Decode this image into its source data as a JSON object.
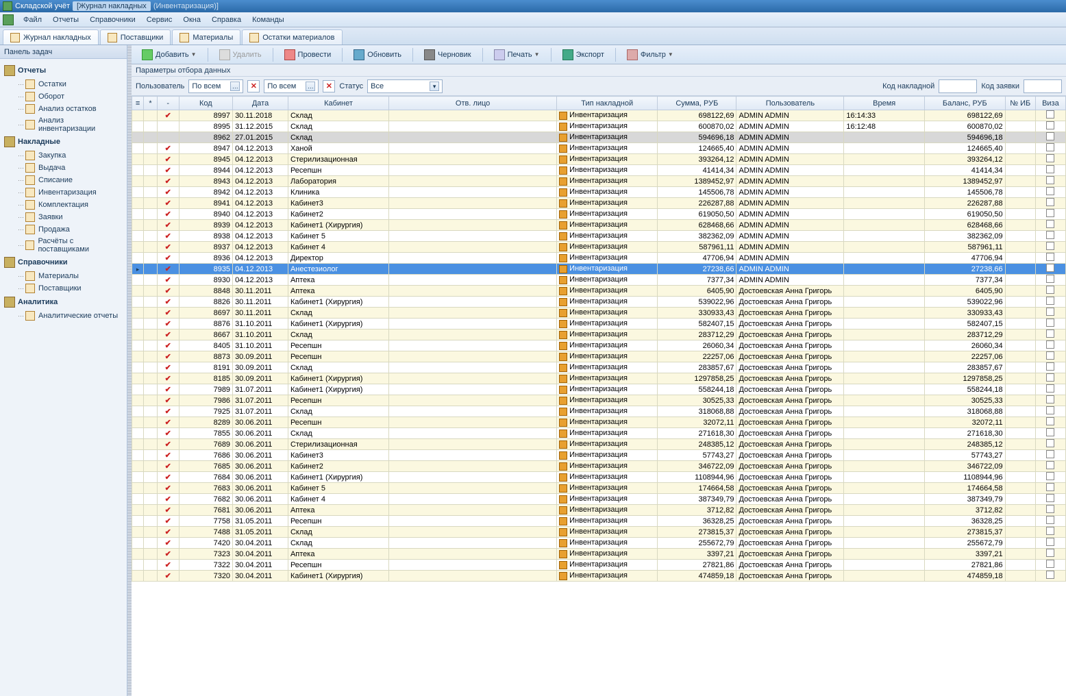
{
  "title": {
    "app": "Складской учёт",
    "active_tab": "[Журнал накладных",
    "subtitle": "(Инвентаризация)]"
  },
  "menu": [
    "Файл",
    "Отчеты",
    "Справочники",
    "Сервис",
    "Окна",
    "Справка",
    "Команды"
  ],
  "tabs": [
    {
      "label": "Журнал накладных",
      "active": true
    },
    {
      "label": "Поставщики",
      "active": false
    },
    {
      "label": "Материалы",
      "active": false
    },
    {
      "label": "Остатки материалов",
      "active": false
    }
  ],
  "sidepanel": {
    "title": "Панель задач",
    "groups": [
      {
        "title": "Отчеты",
        "items": [
          "Остатки",
          "Оборот",
          "Анализ остатков",
          "Анализ инвентаризации"
        ]
      },
      {
        "title": "Накладные",
        "items": [
          "Закупка",
          "Выдача",
          "Списание",
          "Инвентаризация",
          "Комплектация",
          "Заявки",
          "Продажа",
          "Расчёты с поставщиками"
        ]
      },
      {
        "title": "Справочники",
        "items": [
          "Материалы",
          "Поставщики"
        ]
      },
      {
        "title": "Аналитика",
        "items": [
          "Аналитические отчеты"
        ]
      }
    ]
  },
  "toolbar": {
    "add": "Добавить",
    "del": "Удалить",
    "post": "Провести",
    "refresh": "Обновить",
    "draft": "Черновик",
    "print": "Печать",
    "export": "Экспорт",
    "filter": "Фильтр"
  },
  "params": {
    "title": "Параметры отбора данных",
    "user_label": "Пользователь",
    "user_value": "По всем",
    "combo2_value": "По всем",
    "status_label": "Статус",
    "status_value": "Все",
    "code_label": "Код накладной",
    "req_label": "Код заявки"
  },
  "grid": {
    "headers": {
      "star": "*",
      "minus": "-",
      "code": "Код",
      "date": "Дата",
      "cab": "Кабинет",
      "resp": "Отв. лицо",
      "type": "Тип накладной",
      "sum": "Сумма, РУБ",
      "user": "Пользователь",
      "time": "Время",
      "bal": "Баланс, РУБ",
      "ib": "№ ИБ",
      "visa": "Виза"
    },
    "type_label": "Инвентаризация",
    "rows": [
      {
        "check": true,
        "code": "8997",
        "date": "30.11.2018",
        "cab": "Склад",
        "sum": "698122,69",
        "user": "ADMIN ADMIN",
        "time": "16:14:33",
        "bal": "698122,69"
      },
      {
        "check": false,
        "code": "8995",
        "date": "31.12.2015",
        "cab": "Склад",
        "sum": "600870,02",
        "user": "ADMIN ADMIN",
        "time": "16:12:48",
        "bal": "600870,02"
      },
      {
        "grey": true,
        "check": false,
        "code": "8962",
        "date": "27.01.2015",
        "cab": "Склад",
        "sum": "594696,18",
        "user": "ADMIN ADMIN",
        "bal": "594696,18"
      },
      {
        "check": true,
        "code": "8947",
        "date": "04.12.2013",
        "cab": "Ханой",
        "sum": "124665,40",
        "user": "ADMIN ADMIN",
        "bal": "124665,40"
      },
      {
        "check": true,
        "code": "8945",
        "date": "04.12.2013",
        "cab": "Стерилизационная",
        "sum": "393264,12",
        "user": "ADMIN ADMIN",
        "bal": "393264,12"
      },
      {
        "check": true,
        "code": "8944",
        "date": "04.12.2013",
        "cab": "Ресепшн",
        "sum": "41414,34",
        "user": "ADMIN ADMIN",
        "bal": "41414,34"
      },
      {
        "check": true,
        "code": "8943",
        "date": "04.12.2013",
        "cab": "Лаборатория",
        "sum": "1389452,97",
        "user": "ADMIN ADMIN",
        "bal": "1389452,97"
      },
      {
        "check": true,
        "code": "8942",
        "date": "04.12.2013",
        "cab": "Клиника",
        "sum": "145506,78",
        "user": "ADMIN ADMIN",
        "bal": "145506,78"
      },
      {
        "check": true,
        "code": "8941",
        "date": "04.12.2013",
        "cab": "Кабинет3",
        "sum": "226287,88",
        "user": "ADMIN ADMIN",
        "bal": "226287,88"
      },
      {
        "check": true,
        "code": "8940",
        "date": "04.12.2013",
        "cab": "Кабинет2",
        "sum": "619050,50",
        "user": "ADMIN ADMIN",
        "bal": "619050,50"
      },
      {
        "check": true,
        "code": "8939",
        "date": "04.12.2013",
        "cab": "Кабинет1 (Хирургия)",
        "sum": "628468,66",
        "user": "ADMIN ADMIN",
        "bal": "628468,66"
      },
      {
        "check": true,
        "code": "8938",
        "date": "04.12.2013",
        "cab": "Кабинет 5",
        "sum": "382362,09",
        "user": "ADMIN ADMIN",
        "bal": "382362,09"
      },
      {
        "check": true,
        "code": "8937",
        "date": "04.12.2013",
        "cab": "Кабинет 4",
        "sum": "587961,11",
        "user": "ADMIN ADMIN",
        "bal": "587961,11"
      },
      {
        "check": true,
        "code": "8936",
        "date": "04.12.2013",
        "cab": "Директор",
        "sum": "47706,94",
        "user": "ADMIN ADMIN",
        "bal": "47706,94"
      },
      {
        "selected": true,
        "ptr": true,
        "check": true,
        "code": "8935",
        "date": "04.12.2013",
        "cab": "Анестезиолог",
        "sum": "27238,66",
        "user": "ADMIN ADMIN",
        "bal": "27238,66"
      },
      {
        "check": true,
        "code": "8930",
        "date": "04.12.2013",
        "cab": "Аптека",
        "sum": "7377,34",
        "user": "ADMIN ADMIN",
        "bal": "7377,34"
      },
      {
        "check": true,
        "code": "8848",
        "date": "30.11.2011",
        "cab": "Аптека",
        "sum": "6405,90",
        "user": "Достоевская Анна Григорь",
        "bal": "6405,90"
      },
      {
        "check": true,
        "code": "8826",
        "date": "30.11.2011",
        "cab": "Кабинет1 (Хирургия)",
        "sum": "539022,96",
        "user": "Достоевская Анна Григорь",
        "bal": "539022,96"
      },
      {
        "check": true,
        "code": "8697",
        "date": "30.11.2011",
        "cab": "Склад",
        "sum": "330933,43",
        "user": "Достоевская Анна Григорь",
        "bal": "330933,43"
      },
      {
        "check": true,
        "code": "8876",
        "date": "31.10.2011",
        "cab": "Кабинет1 (Хирургия)",
        "sum": "582407,15",
        "user": "Достоевская Анна Григорь",
        "bal": "582407,15"
      },
      {
        "check": true,
        "code": "8667",
        "date": "31.10.2011",
        "cab": "Склад",
        "sum": "283712,29",
        "user": "Достоевская Анна Григорь",
        "bal": "283712,29"
      },
      {
        "check": true,
        "code": "8405",
        "date": "31.10.2011",
        "cab": "Ресепшн",
        "sum": "26060,34",
        "user": "Достоевская Анна Григорь",
        "bal": "26060,34"
      },
      {
        "check": true,
        "code": "8873",
        "date": "30.09.2011",
        "cab": "Ресепшн",
        "sum": "22257,06",
        "user": "Достоевская Анна Григорь",
        "bal": "22257,06"
      },
      {
        "check": true,
        "code": "8191",
        "date": "30.09.2011",
        "cab": "Склад",
        "sum": "283857,67",
        "user": "Достоевская Анна Григорь",
        "bal": "283857,67"
      },
      {
        "check": true,
        "code": "8185",
        "date": "30.09.2011",
        "cab": "Кабинет1 (Хирургия)",
        "sum": "1297858,25",
        "user": "Достоевская Анна Григорь",
        "bal": "1297858,25"
      },
      {
        "check": true,
        "code": "7989",
        "date": "31.07.2011",
        "cab": "Кабинет1 (Хирургия)",
        "sum": "558244,18",
        "user": "Достоевская Анна Григорь",
        "bal": "558244,18"
      },
      {
        "check": true,
        "code": "7986",
        "date": "31.07.2011",
        "cab": "Ресепшн",
        "sum": "30525,33",
        "user": "Достоевская Анна Григорь",
        "bal": "30525,33"
      },
      {
        "check": true,
        "code": "7925",
        "date": "31.07.2011",
        "cab": "Склад",
        "sum": "318068,88",
        "user": "Достоевская Анна Григорь",
        "bal": "318068,88"
      },
      {
        "check": true,
        "code": "8289",
        "date": "30.06.2011",
        "cab": "Ресепшн",
        "sum": "32072,11",
        "user": "Достоевская Анна Григорь",
        "bal": "32072,11"
      },
      {
        "check": true,
        "code": "7855",
        "date": "30.06.2011",
        "cab": "Склад",
        "sum": "271618,30",
        "user": "Достоевская Анна Григорь",
        "bal": "271618,30"
      },
      {
        "check": true,
        "code": "7689",
        "date": "30.06.2011",
        "cab": "Стерилизационная",
        "sum": "248385,12",
        "user": "Достоевская Анна Григорь",
        "bal": "248385,12"
      },
      {
        "check": true,
        "code": "7686",
        "date": "30.06.2011",
        "cab": "Кабинет3",
        "sum": "57743,27",
        "user": "Достоевская Анна Григорь",
        "bal": "57743,27"
      },
      {
        "check": true,
        "code": "7685",
        "date": "30.06.2011",
        "cab": "Кабинет2",
        "sum": "346722,09",
        "user": "Достоевская Анна Григорь",
        "bal": "346722,09"
      },
      {
        "check": true,
        "code": "7684",
        "date": "30.06.2011",
        "cab": "Кабинет1 (Хирургия)",
        "sum": "1108944,96",
        "user": "Достоевская Анна Григорь",
        "bal": "1108944,96"
      },
      {
        "check": true,
        "code": "7683",
        "date": "30.06.2011",
        "cab": "Кабинет 5",
        "sum": "174664,58",
        "user": "Достоевская Анна Григорь",
        "bal": "174664,58"
      },
      {
        "check": true,
        "code": "7682",
        "date": "30.06.2011",
        "cab": "Кабинет 4",
        "sum": "387349,79",
        "user": "Достоевская Анна Григорь",
        "bal": "387349,79"
      },
      {
        "check": true,
        "code": "7681",
        "date": "30.06.2011",
        "cab": "Аптека",
        "sum": "3712,82",
        "user": "Достоевская Анна Григорь",
        "bal": "3712,82"
      },
      {
        "check": true,
        "code": "7758",
        "date": "31.05.2011",
        "cab": "Ресепшн",
        "sum": "36328,25",
        "user": "Достоевская Анна Григорь",
        "bal": "36328,25"
      },
      {
        "check": true,
        "code": "7488",
        "date": "31.05.2011",
        "cab": "Склад",
        "sum": "273815,37",
        "user": "Достоевская Анна Григорь",
        "bal": "273815,37"
      },
      {
        "check": true,
        "code": "7420",
        "date": "30.04.2011",
        "cab": "Склад",
        "sum": "255672,79",
        "user": "Достоевская Анна Григорь",
        "bal": "255672,79"
      },
      {
        "check": true,
        "code": "7323",
        "date": "30.04.2011",
        "cab": "Аптека",
        "sum": "3397,21",
        "user": "Достоевская Анна Григорь",
        "bal": "3397,21"
      },
      {
        "check": true,
        "code": "7322",
        "date": "30.04.2011",
        "cab": "Ресепшн",
        "sum": "27821,86",
        "user": "Достоевская Анна Григорь",
        "bal": "27821,86"
      },
      {
        "check": true,
        "code": "7320",
        "date": "30.04.2011",
        "cab": "Кабинет1 (Хирургия)",
        "sum": "474859,18",
        "user": "Достоевская Анна Григорь",
        "bal": "474859,18"
      }
    ]
  }
}
